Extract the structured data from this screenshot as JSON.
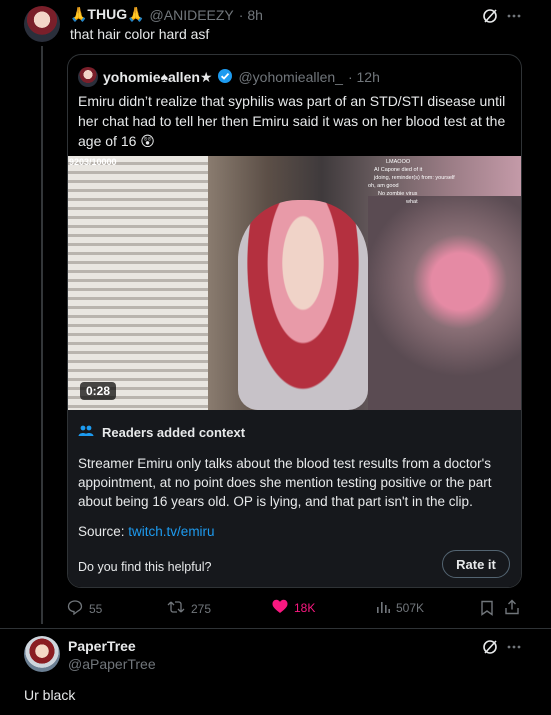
{
  "post": {
    "display_name": "🙏THUG🙏",
    "handle": "@ANIDEEZY",
    "time": "· 8h",
    "text": "that hair color hard asf",
    "grok_icon": "grok-slash-icon",
    "more_icon": "more-horizontal-icon"
  },
  "quote": {
    "display_name": "yohomie♠allen★",
    "verified": true,
    "handle": "@yohomieallen_",
    "time": "· 12h",
    "text": "Emiru didn’t realize that syphilis was part of an STD/STI disease until her chat had to tell her then Emiru said it was on her blood test at the age of 16 😲",
    "video": {
      "duration": "0:28",
      "overlay_counter": "9203/10000",
      "chat_lines": [
        "LMAOOO",
        "AI Capone died of it",
        "jdoing, reminder(s) from: yourself",
        "oh, am good",
        "No zombie virus",
        "what"
      ]
    },
    "context_note": {
      "title": "Readers added context",
      "body": "Streamer Emiru only talks about the blood test results from a doctor's appointment, at no point does she mention testing positive or the part about being 16 years old. OP is lying, and that part isn't in the clip.",
      "source_label": "Source:",
      "source_link": "twitch.tv/emiru",
      "helpful_question": "Do you find this helpful?",
      "rate_button": "Rate it"
    }
  },
  "actions": {
    "replies": "55",
    "reposts": "275",
    "likes": "18K",
    "views": "507K",
    "like_color": "#f91880"
  },
  "reply": {
    "display_name": "PaperTree",
    "handle": "@aPaperTree",
    "text": "Ur black"
  },
  "colors": {
    "background": "#000000",
    "text": "#e7e9ea",
    "muted": "#71767b",
    "link": "#1d9bf0",
    "border": "#2f3336"
  }
}
